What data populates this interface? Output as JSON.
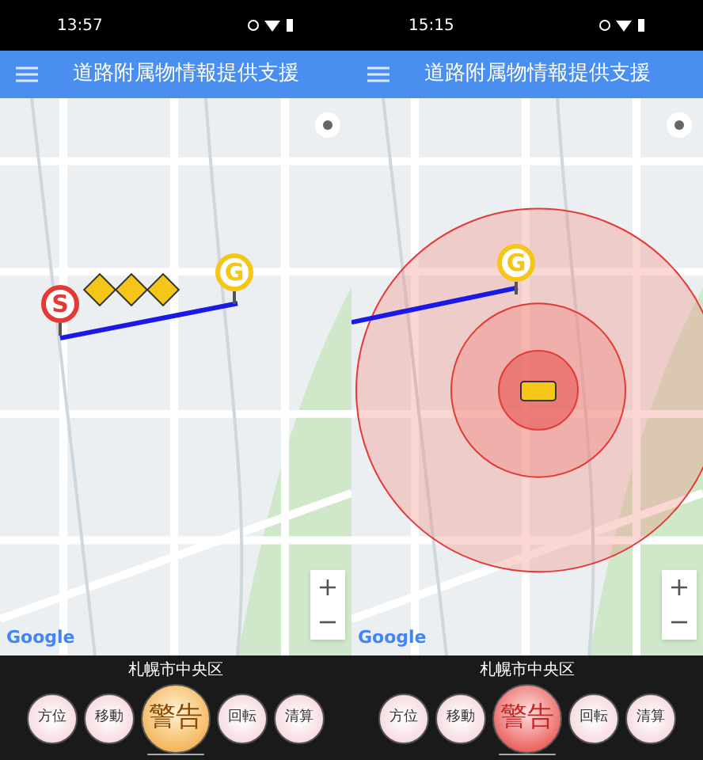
{
  "phones": [
    {
      "kind": "route",
      "status_time": "13:57",
      "title": "道路附属物情報提供支援",
      "start_marker": "S",
      "goal_marker": "G",
      "map_credit": "Google",
      "zoom_in": "+",
      "zoom_out": "−",
      "district": "札幌市中央区",
      "buttons": [
        {
          "label": "方位",
          "selected": false
        },
        {
          "label": "移動",
          "selected": false
        },
        {
          "label": "警告",
          "selected": true
        },
        {
          "label": "回転",
          "selected": false
        },
        {
          "label": "清算",
          "selected": false
        }
      ]
    },
    {
      "kind": "radius",
      "status_time": "15:15",
      "title": "道路附属物情報提供支援",
      "goal_marker": "G",
      "map_credit": "Google",
      "zoom_in": "+",
      "zoom_out": "−",
      "district": "札幌市中央区",
      "buttons": [
        {
          "label": "方位",
          "selected": false
        },
        {
          "label": "移動",
          "selected": false
        },
        {
          "label": "警告",
          "selected": true
        },
        {
          "label": "回転",
          "selected": false
        },
        {
          "label": "清算",
          "selected": false
        }
      ]
    }
  ]
}
